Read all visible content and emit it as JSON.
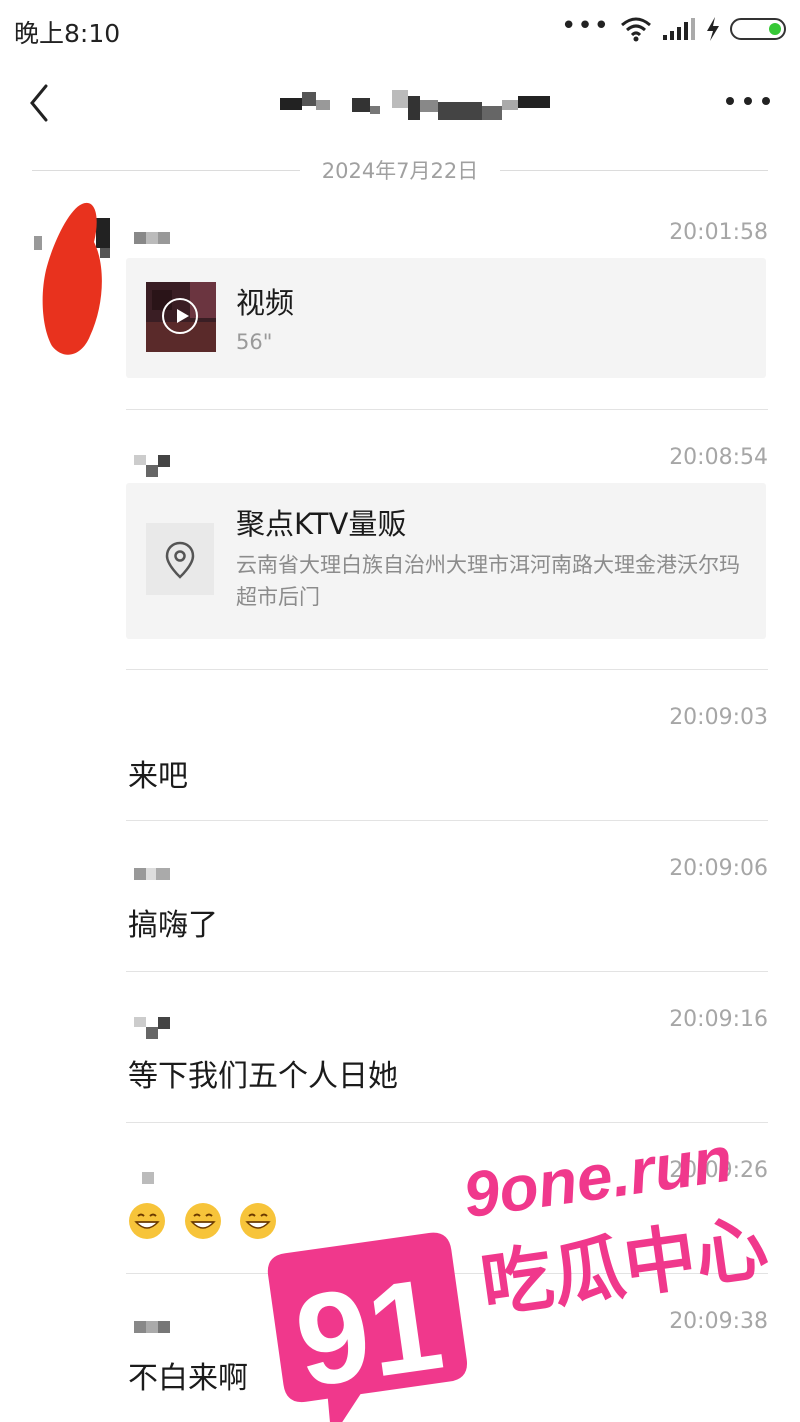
{
  "status_bar": {
    "time": "晚上8:10"
  },
  "header": {
    "title": ""
  },
  "date_divider": "2024年7月22日",
  "messages": [
    {
      "time": "20:01:58",
      "type": "video",
      "card_title": "视频",
      "duration": "56\""
    },
    {
      "time": "20:08:54",
      "type": "location",
      "card_title": "聚点KTV量贩",
      "address": "云南省大理白族自治州大理市洱河南路大理金港沃尔玛超市后门"
    },
    {
      "time": "20:09:03",
      "type": "text",
      "text": "来吧"
    },
    {
      "time": "20:09:06",
      "type": "text",
      "text": "搞嗨了"
    },
    {
      "time": "20:09:16",
      "type": "text",
      "text": "等下我们五个人日她"
    },
    {
      "time": "20:09:26",
      "type": "emoji",
      "emoji": "grinning-face-x3"
    },
    {
      "time": "20:09:38",
      "type": "text",
      "text": "不白来啊"
    }
  ],
  "watermark": {
    "brand_number": "91",
    "domain": "9one.run",
    "name": "吃瓜中心",
    "color": "#f0388c"
  },
  "colors": {
    "battery_fill": "#37c837",
    "avatar_scribble": "#e8321e"
  },
  "icons": [
    "back-chevron-icon",
    "more-icon",
    "wifi-icon",
    "signal-icon",
    "charging-icon",
    "battery-icon",
    "play-icon",
    "location-pin-icon",
    "grinning-emoji-icon"
  ]
}
